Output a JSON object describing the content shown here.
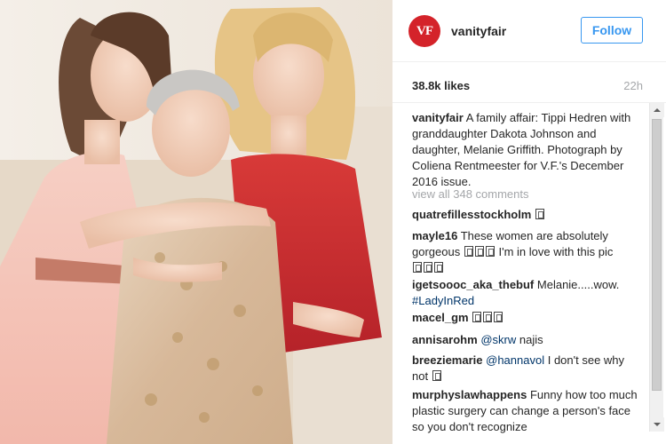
{
  "post": {
    "avatar_text": "VF",
    "username": "vanityfair",
    "follow_label": "Follow",
    "likes": "38.8k likes",
    "time": "22h",
    "caption_user": "vanityfair",
    "caption_text": "A family affair: Tippi Hedren with granddaughter Dakota Johnson and daughter, Melanie Griffith. Photograph by Coliena Rentmeester for V.F.'s December 2016 issue.",
    "view_all": "view all 348 comments"
  },
  "comments": [
    {
      "user": "quatrefillesstockholm",
      "text": ""
    },
    {
      "user": "mayle16",
      "text": "These women are absolutely gorgeous",
      "text2": "I'm in love with this pic"
    },
    {
      "user": "igetsoooc_aka_thebuf",
      "text": "Melanie.....wow.",
      "hashtag": "#LadyInRed"
    },
    {
      "user": "macel_gm",
      "text": ""
    },
    {
      "user": "annisarohm",
      "mention": "@skrw",
      "text": "najis"
    },
    {
      "user": "breeziemarie",
      "mention": "@hannavol",
      "text": "I don't see why not"
    },
    {
      "user": "murphyslawhappens",
      "text": "Funny how too much plastic surgery can change a person's face so you don't recognize"
    }
  ],
  "icons": {
    "avatar": "vanity-fair-logo",
    "scroll_up": "arrow-up-icon",
    "scroll_down": "arrow-down-icon"
  },
  "colors": {
    "brand_red": "#d4232a",
    "follow_blue": "#3897f0",
    "link_blue": "#003569",
    "muted": "#a5a7aa"
  }
}
